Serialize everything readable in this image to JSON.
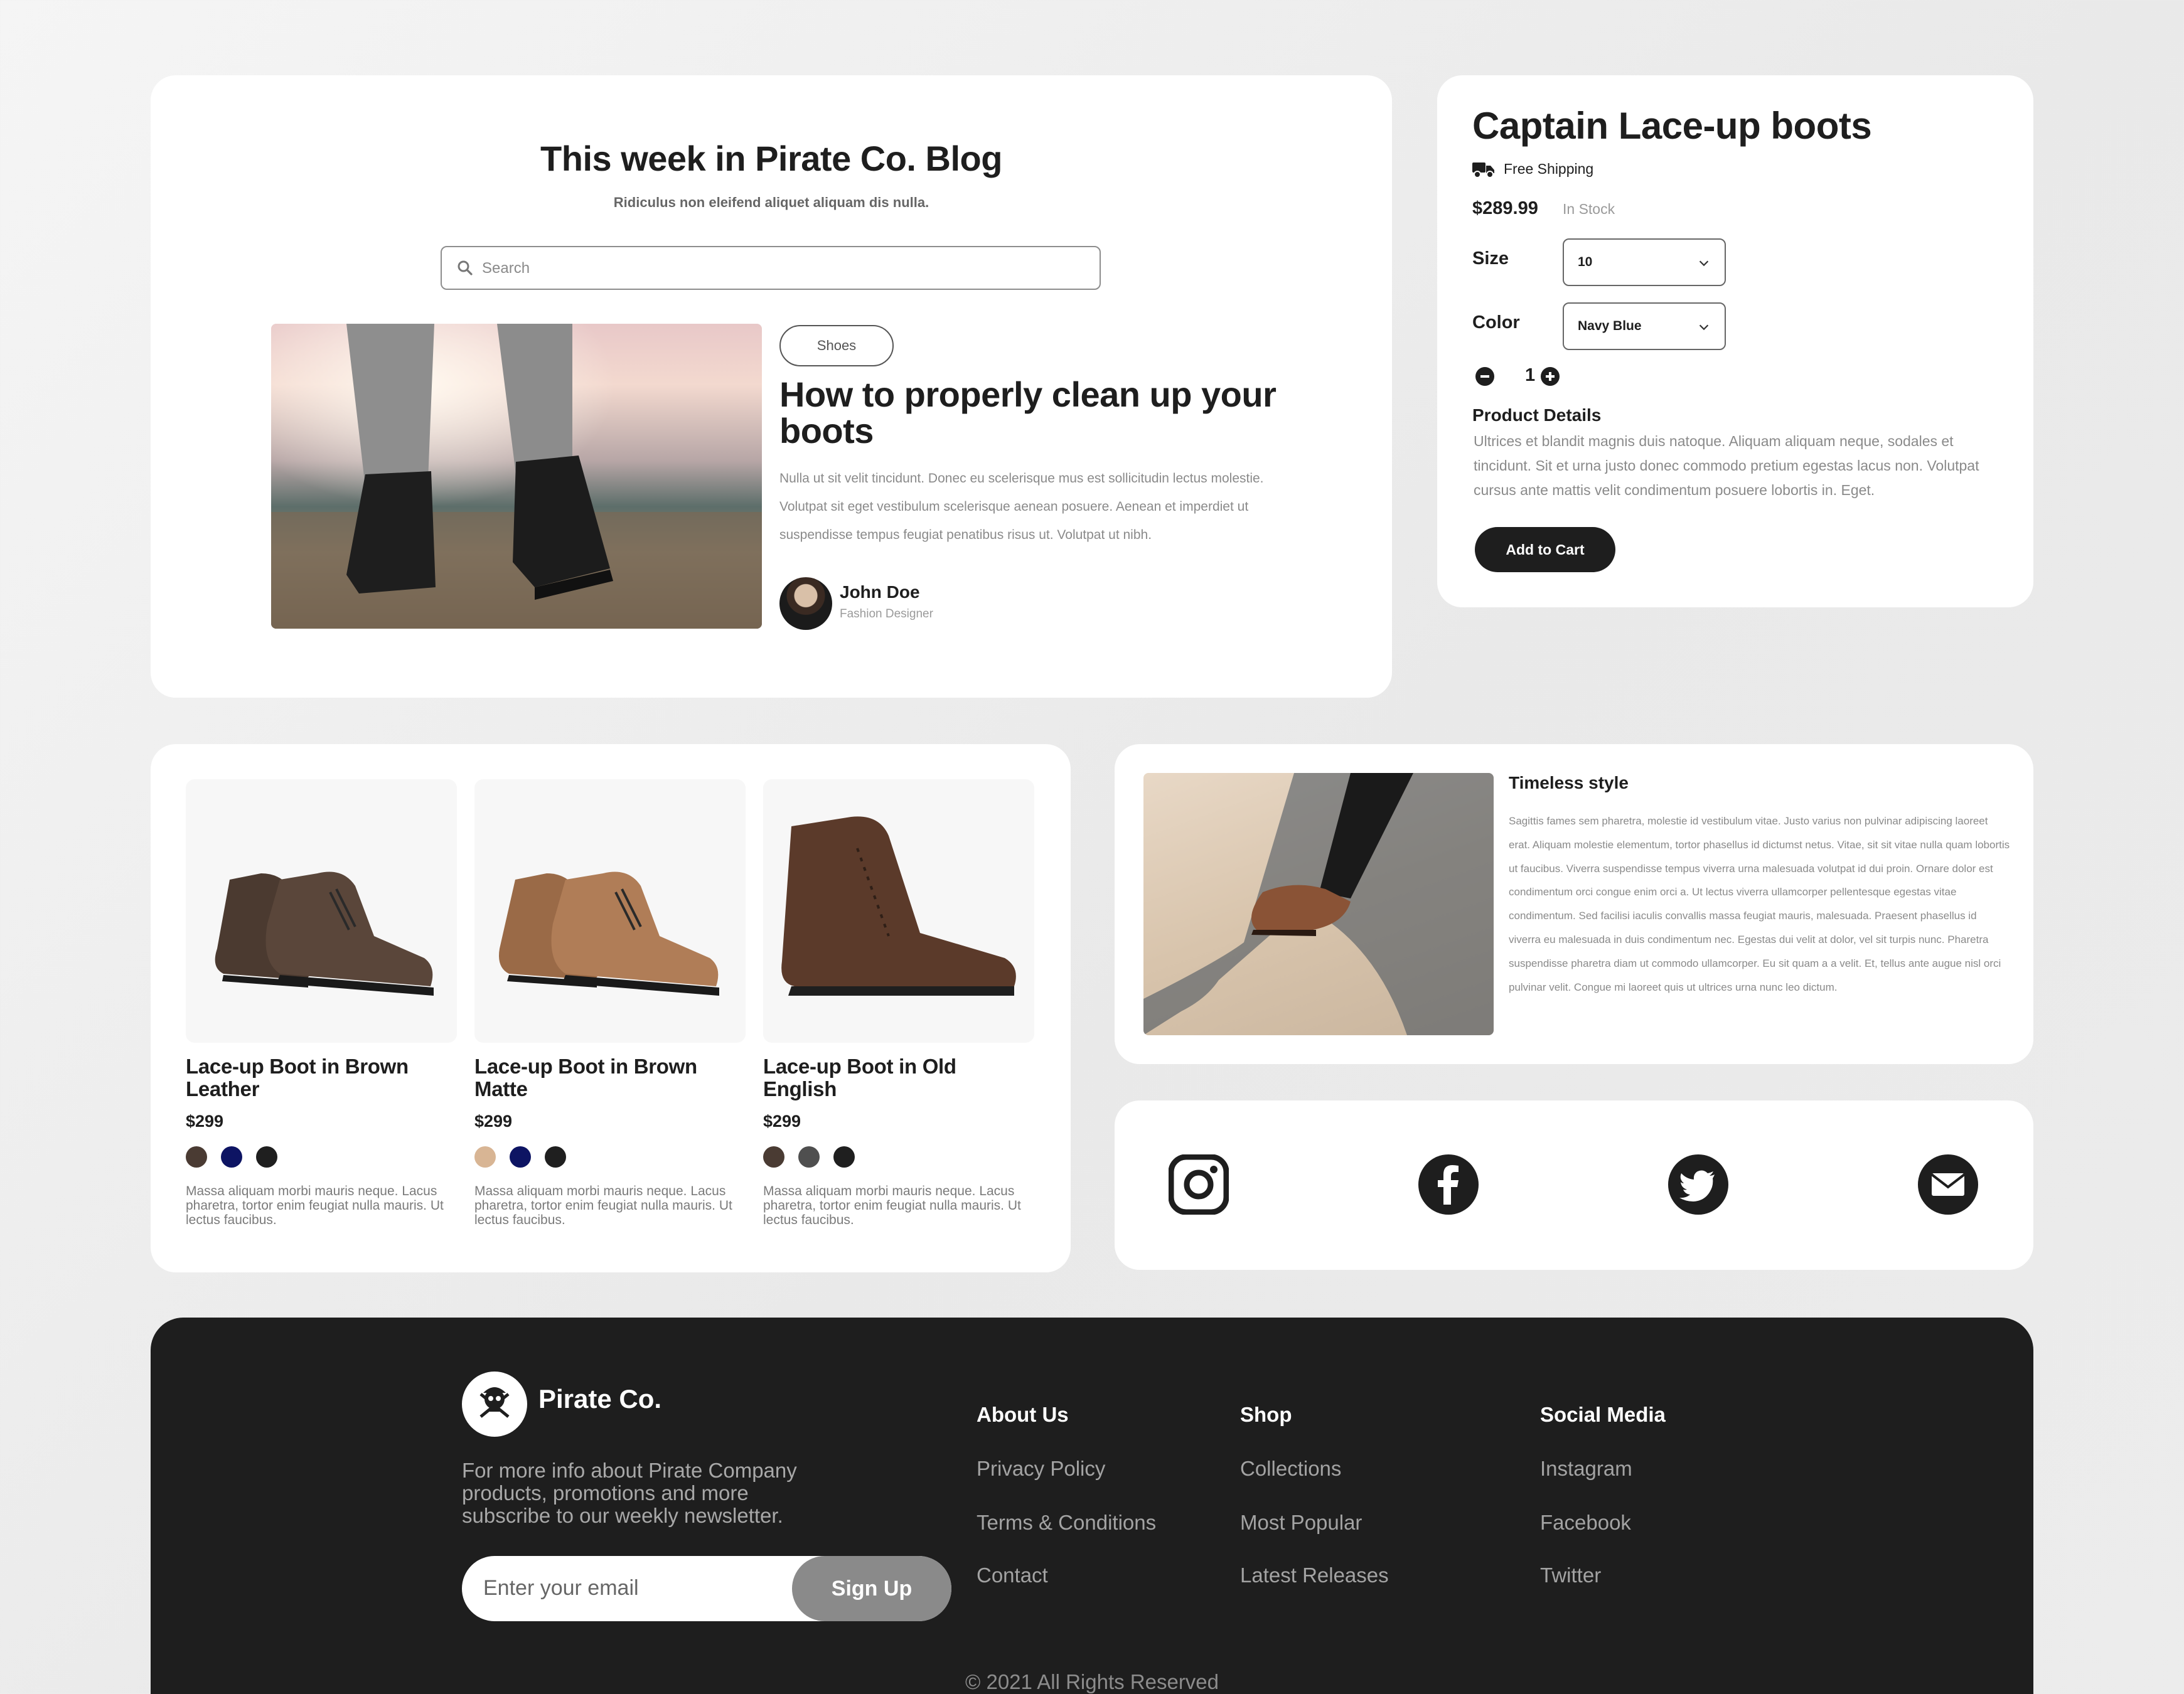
{
  "blog": {
    "title": "This week in Pirate Co. Blog",
    "subtitle": "Ridiculus non eleifend aliquet aliquam dis nulla.",
    "search_placeholder": "Search",
    "tag": "Shoes",
    "article_title": "How to properly clean up your boots",
    "article_body": "Nulla ut sit velit tincidunt. Donec eu scelerisque mus est sollicitudin lectus molestie. Volutpat sit eget vestibulum scelerisque aenean posuere. Aenean et imperdiet ut suspendisse tempus feugiat penatibus risus ut. Volutpat ut nibh.",
    "author_name": "John Doe",
    "author_role": "Fashion Designer"
  },
  "product": {
    "title": "Captain Lace-up boots",
    "shipping": "Free Shipping",
    "price": "$289.99",
    "stock": "In Stock",
    "size_label": "Size",
    "size_value": "10",
    "color_label": "Color",
    "color_value": "Navy Blue",
    "quantity": "1",
    "details_heading": "Product Details",
    "details_body": "Ultrices et blandit magnis duis natoque. Aliquam aliquam neque, sodales et tincidunt. Sit et urna justo donec commodo pretium egestas lacus non. Volutpat cursus ante mattis velit condimentum posuere lobortis in. Eget.",
    "add_to_cart": "Add to Cart"
  },
  "shop": {
    "items": [
      {
        "name": "Lace-up Boot in Brown Leather",
        "price": "$299",
        "swatches": [
          "#4a3b33",
          "#0d1463",
          "#1f1f1f"
        ],
        "desc": "Massa aliquam morbi mauris neque. Lacus pharetra, tortor enim feugiat nulla mauris. Ut lectus faucibus."
      },
      {
        "name": "Lace-up Boot in Brown Matte",
        "price": "$299",
        "swatches": [
          "#d8b594",
          "#0d1463",
          "#1f1f1f"
        ],
        "desc": "Massa aliquam morbi mauris neque. Lacus pharetra, tortor enim feugiat nulla mauris. Ut lectus faucibus."
      },
      {
        "name": "Lace-up Boot in Old English",
        "price": "$299",
        "swatches": [
          "#4a3b33",
          "#4f4f4f",
          "#1f1f1f"
        ],
        "desc": "Massa aliquam morbi mauris neque. Lacus pharetra, tortor enim feugiat nulla mauris. Ut lectus faucibus."
      }
    ]
  },
  "timeless": {
    "heading": "Timeless style",
    "body": "Sagittis fames sem pharetra, molestie id vestibulum vitae. Justo varius non pulvinar adipiscing laoreet erat. Aliquam molestie elementum, tortor phasellus id dictumst netus. Vitae, sit sit vitae nulla quam lobortis ut faucibus. Viverra suspendisse tempus viverra urna malesuada volutpat id dui proin. Ornare dolor est condimentum orci congue enim orci a. Ut lectus viverra ullamcorper pellentesque egestas vitae condimentum. Sed facilisi iaculis convallis massa feugiat mauris, malesuada. Praesent phasellus id viverra eu malesuada in duis condimentum nec. Egestas dui velit at dolor, vel sit turpis nunc. Pharetra suspendisse pharetra diam ut commodo ullamcorper. Eu sit quam a a velit. Et, tellus ante augue nisl orci pulvinar velit. Congue mi laoreet quis ut ultrices urna nunc leo dictum."
  },
  "social_icons": [
    "instagram-icon",
    "facebook-icon",
    "twitter-icon",
    "mail-icon"
  ],
  "footer": {
    "brand": "Pirate Co.",
    "description": "For more info about Pirate Company products, promotions and more subscribe to our weekly newsletter.",
    "email_placeholder": "Enter your email",
    "signup": "Sign Up",
    "columns": [
      {
        "heading": "About Us",
        "links": [
          "Privacy Policy",
          "Terms & Conditions",
          "Contact"
        ]
      },
      {
        "heading": "Shop",
        "links": [
          "Collections",
          "Most Popular",
          "Latest Releases"
        ]
      },
      {
        "heading": "Social Media",
        "links": [
          "Instagram",
          "Facebook",
          "Twitter"
        ]
      }
    ],
    "copyright": "© 2021 All Rights Reserved"
  }
}
